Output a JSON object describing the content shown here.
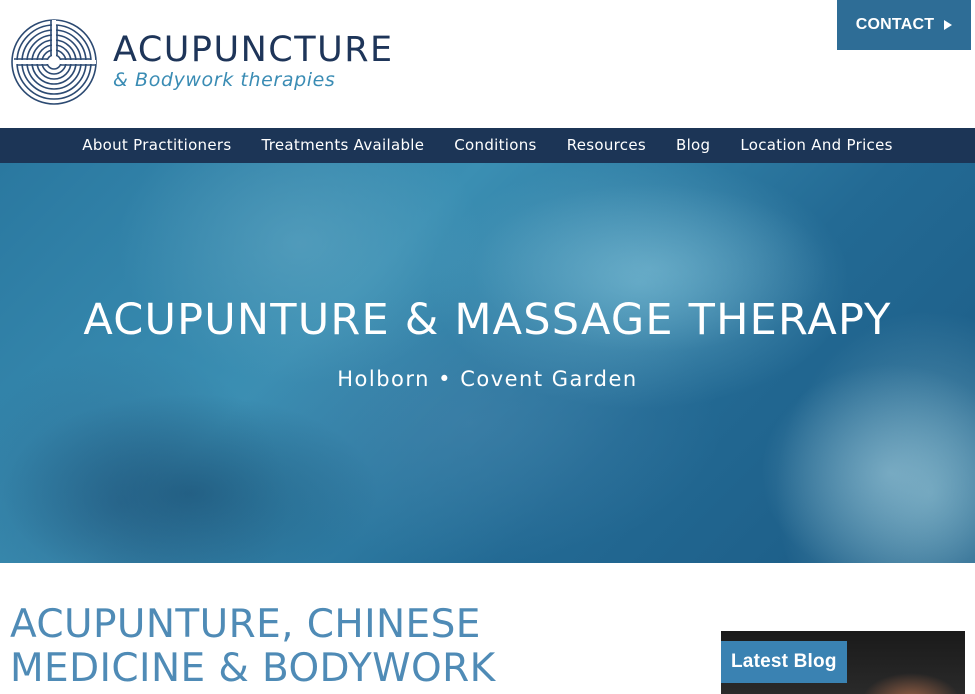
{
  "brand": {
    "title": "ACUPUNCTURE",
    "subtitle": "& Bodywork therapies",
    "logo_icon": "labyrinth-logo-icon"
  },
  "header": {
    "contact_label": "CONTACT",
    "contact_icon": "play-arrow-icon"
  },
  "nav": {
    "items": [
      {
        "label": "About Practitioners"
      },
      {
        "label": "Treatments Available"
      },
      {
        "label": "Conditions"
      },
      {
        "label": "Resources"
      },
      {
        "label": "Blog"
      },
      {
        "label": "Location And Prices"
      }
    ]
  },
  "hero": {
    "title": "ACUPUNTURE & MASSAGE THERAPY",
    "subtitle": "Holborn • Covent Garden"
  },
  "main": {
    "heading_line1": "ACUPUNTURE, CHINESE",
    "heading_line2": "MEDICINE & BODYWORK"
  },
  "sidebar": {
    "blog_label": "Latest Blog"
  },
  "colors": {
    "navy": "#1c3556",
    "brand_text": "#1e3559",
    "accent_blue": "#2e6d96",
    "light_blue": "#4f8bb6",
    "blog_blue": "#3a82b2"
  }
}
